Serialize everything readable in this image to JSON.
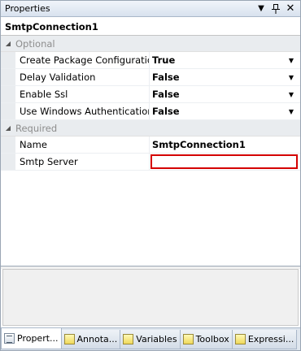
{
  "window": {
    "title": "Properties",
    "pin_icon": "pin-icon",
    "close_glyph": "✕"
  },
  "object": {
    "name": "SmtpConnection1"
  },
  "categories": [
    {
      "label": "Optional",
      "expanded_glyph": "◢",
      "properties": [
        {
          "name": "Create Package Configuration",
          "value": "True",
          "has_dropdown": true
        },
        {
          "name": "Delay Validation",
          "value": "False",
          "has_dropdown": true
        },
        {
          "name": "Enable Ssl",
          "value": "False",
          "has_dropdown": true
        },
        {
          "name": "Use Windows Authentication",
          "value": "False",
          "has_dropdown": true
        }
      ]
    },
    {
      "label": "Required",
      "expanded_glyph": "◢",
      "properties": [
        {
          "name": "Name",
          "value": "SmtpConnection1",
          "has_dropdown": false
        },
        {
          "name": "Smtp Server",
          "value": "",
          "has_dropdown": false,
          "invalid": true
        }
      ]
    }
  ],
  "dropdown_glyph": "▼",
  "tabs": [
    {
      "label": "Propert...",
      "icon": "properties-icon",
      "active": true
    },
    {
      "label": "Annota...",
      "icon": "annotations-icon",
      "active": false
    },
    {
      "label": "Variables",
      "icon": "variables-icon",
      "active": false
    },
    {
      "label": "Toolbox",
      "icon": "toolbox-icon",
      "active": false
    },
    {
      "label": "Expressi...",
      "icon": "expressions-icon",
      "active": false
    }
  ],
  "colors": {
    "invalid_border": "#d40000",
    "category_background": "#e9ecef"
  }
}
